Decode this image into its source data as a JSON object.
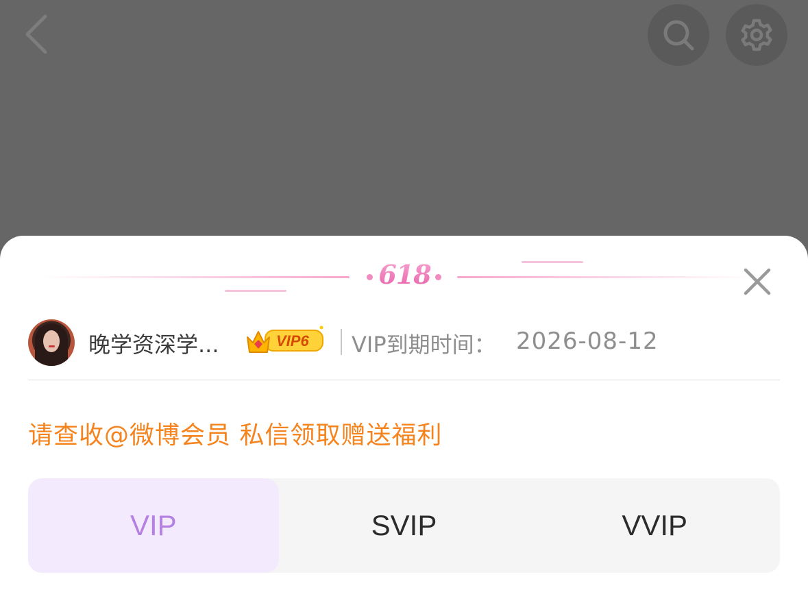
{
  "header": {
    "back_icon": "chevron-left-icon",
    "search_icon": "search-icon",
    "settings_icon": "gear-icon"
  },
  "sheet": {
    "banner_label": "618",
    "close_icon": "close-icon",
    "user": {
      "name": "晚学资深学...",
      "vip_badge": "VIP6",
      "expire_label": "VIP到期时间：",
      "expire_date": "2026-08-12"
    },
    "promo_text": "请查收@微博会员 私信领取赠送福利",
    "tabs": [
      {
        "label": "VIP",
        "active": true
      },
      {
        "label": "SVIP",
        "active": false
      },
      {
        "label": "VVIP",
        "active": false
      }
    ]
  },
  "colors": {
    "overlay": "#666666",
    "accent_pink": "#f07ab7",
    "promo_orange": "#f5841f",
    "tab_active_text": "#b480e2",
    "tab_active_bg": "#f3ebfd"
  }
}
